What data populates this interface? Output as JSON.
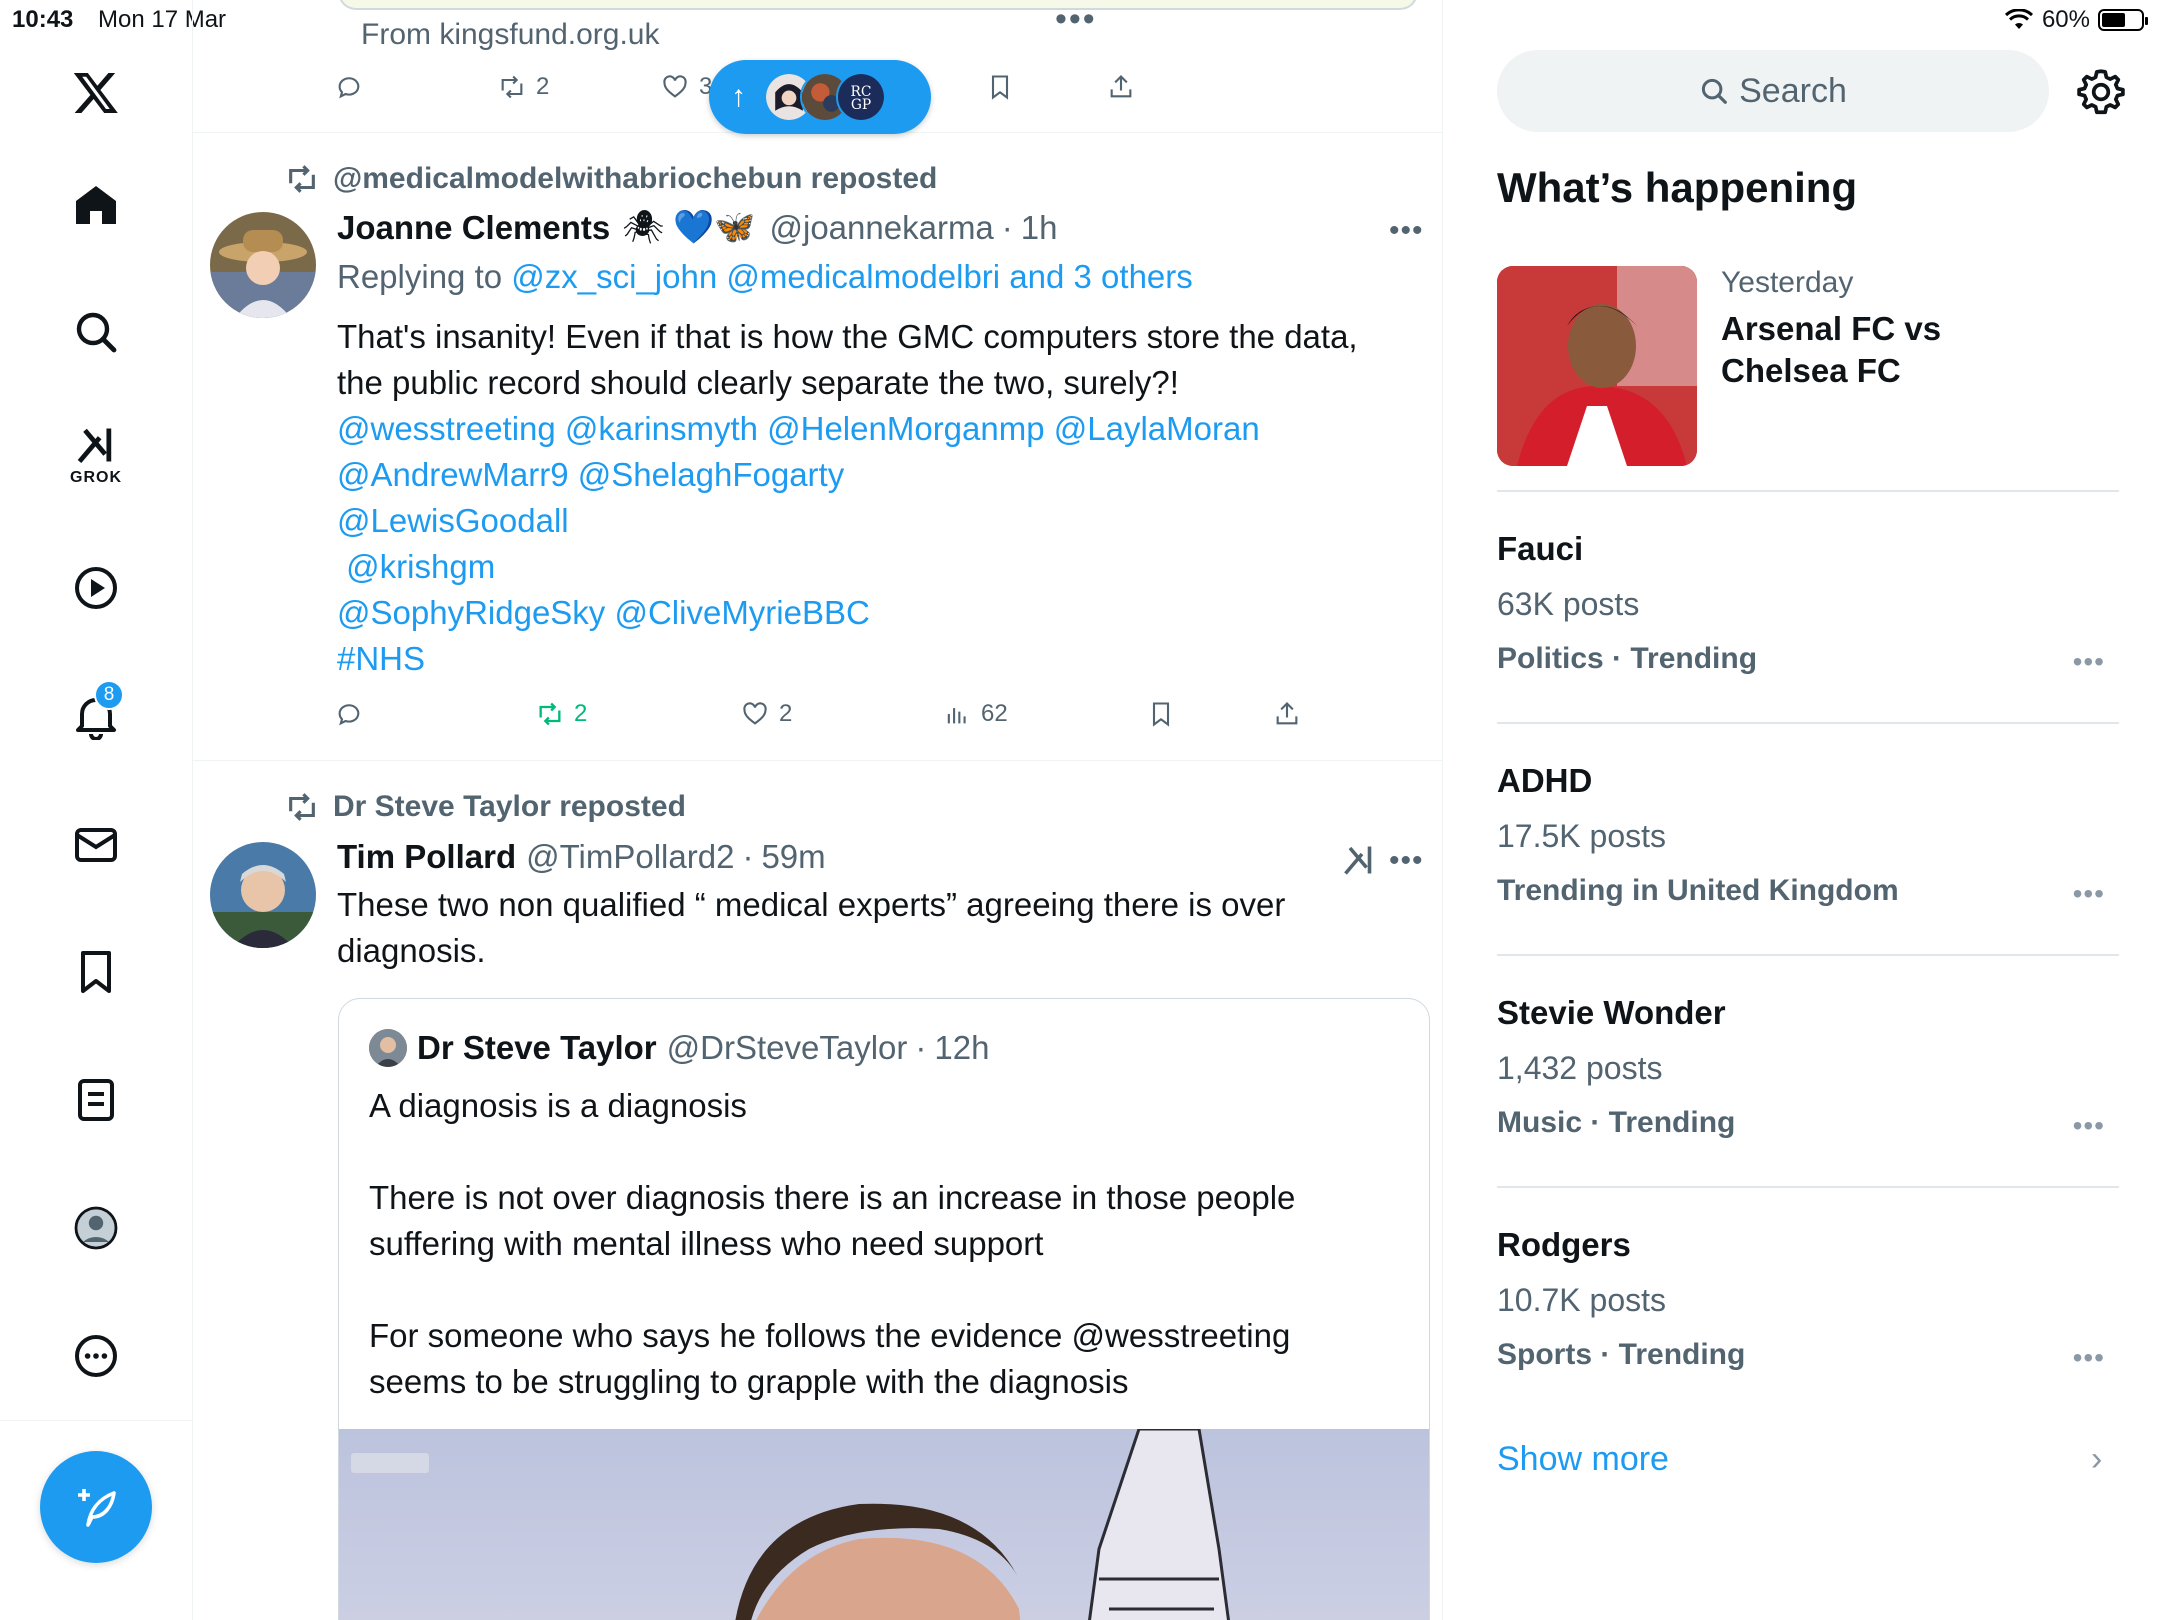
{
  "status": {
    "time": "10:43",
    "date": "Mon 17 Mar",
    "battery": "60%",
    "battery_level": 0.6
  },
  "nav": {
    "grok_label": "GROK",
    "notification_count": "8",
    "items": [
      "x-logo",
      "home-icon",
      "search-icon",
      "grok-icon",
      "video-icon",
      "notifications-icon",
      "messages-icon",
      "bookmarks-icon",
      "lists-icon",
      "profile-icon",
      "more-icon"
    ]
  },
  "feed": {
    "top_post": {
      "source": "From kingsfund.org.uk",
      "retweets": "2",
      "likes": "3"
    },
    "post1": {
      "reposted_by": "@medicalmodelwithabriochebun reposted",
      "name": "Joanne Clements",
      "emojis": "🕷 💙🦋",
      "handle": "@joannekarma",
      "time": "1h",
      "replying_prefix": "Replying to ",
      "replying_to": "@zx_sci_john @medicalmodelbri and 3 others",
      "text_line1": "That's insanity! Even if that is how the GMC computers store the data,",
      "text_line2": "the public record should clearly separate the two, surely?!",
      "mentions_line1": "@wesstreeting @karinsmyth @HelenMorganmp @LaylaMoran",
      "mentions_line2": "@AndrewMarr9 @ShelaghFogarty",
      "mentions_line3": "@LewisGoodall",
      "mentions_line4": " @krishgm",
      "mentions_line5": "@SophyRidgeSky @CliveMyrieBBC",
      "hashtag": "#NHS",
      "retweets": "2",
      "likes": "2",
      "views": "62"
    },
    "post2": {
      "reposted_by": "Dr Steve Taylor reposted",
      "name": "Tim Pollard",
      "handle": "@TimPollard2",
      "time": "59m",
      "text": "These two non qualified “ medical experts” agreeing there is over\ndiagnosis.",
      "quote": {
        "name": "Dr Steve Taylor",
        "handle": "@DrSteveTaylor",
        "time": "12h",
        "text": "A diagnosis is a diagnosis\n\nThere is not over diagnosis there is an increase in those people\nsuffering with mental illness who need support\n\nFor someone who says he follows the evidence @wesstreeting\nseems to be struggling to grapple with the diagnosis"
      }
    }
  },
  "sidebar": {
    "search_placeholder": "Search",
    "whats_happening": "What’s happening",
    "event": {
      "time": "Yesterday",
      "title": "Arsenal FC vs Chelsea FC"
    },
    "trends": [
      {
        "name": "Fauci",
        "posts": "63K posts",
        "category": "Politics · Trending"
      },
      {
        "name": "ADHD",
        "posts": "17.5K posts",
        "category": "Trending in United Kingdom"
      },
      {
        "name": "Stevie Wonder",
        "posts": "1,432 posts",
        "category": "Music · Trending"
      },
      {
        "name": "Rodgers",
        "posts": "10.7K posts",
        "category": "Sports · Trending"
      }
    ],
    "show_more": "Show more"
  },
  "colors": {
    "accent": "#1d9bf0",
    "secondary_text": "#536471",
    "retweet_green": "#00ba7c"
  }
}
